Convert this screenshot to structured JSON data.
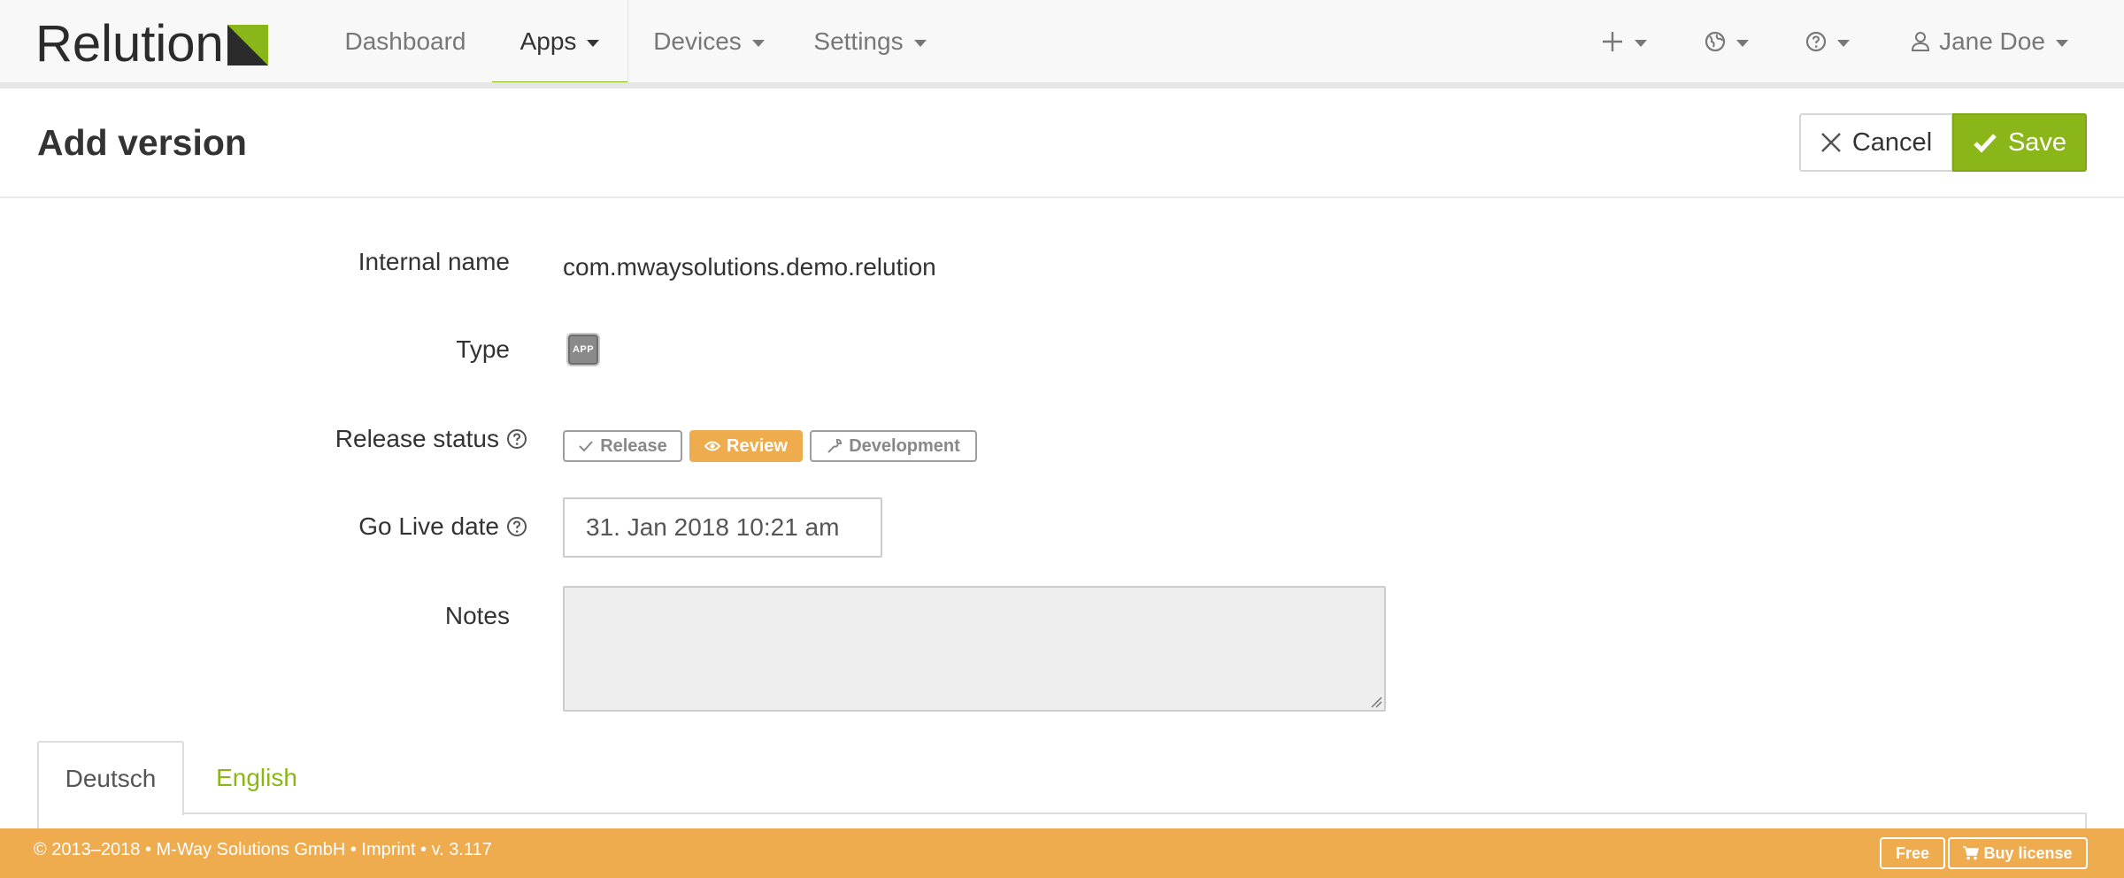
{
  "brand": {
    "name": "Relution",
    "accent_color": "#8ab619",
    "footer_color": "#efac4e"
  },
  "nav": {
    "items": [
      {
        "label": "Dashboard"
      },
      {
        "label": "Apps"
      },
      {
        "label": "Devices"
      },
      {
        "label": "Settings"
      }
    ],
    "active": "Apps",
    "right_icons": [
      "plus-icon",
      "globe-icon",
      "help-icon",
      "user-icon"
    ],
    "user_name": "Jane Doe"
  },
  "page": {
    "title": "Add version",
    "cancel_label": "Cancel",
    "save_label": "Save"
  },
  "form": {
    "internal_name_label": "Internal name",
    "internal_name_value": "com.mwaysolutions.demo.relution",
    "type_label": "Type",
    "type_badge": "APP",
    "release_status_label": "Release status",
    "release_status_options": [
      "Release",
      "Review",
      "Development"
    ],
    "release_status_selected": "Review",
    "go_live_label": "Go Live date",
    "go_live_value": "31. Jan 2018 10:21 am",
    "notes_label": "Notes",
    "notes_value": ""
  },
  "tabs": {
    "items": [
      "Deutsch",
      "English"
    ],
    "active": "Deutsch"
  },
  "footer": {
    "text": "© 2013–2018 • M-Way Solutions GmbH • Imprint • v. 3.117",
    "free_label": "Free",
    "buy_label": "Buy license"
  }
}
